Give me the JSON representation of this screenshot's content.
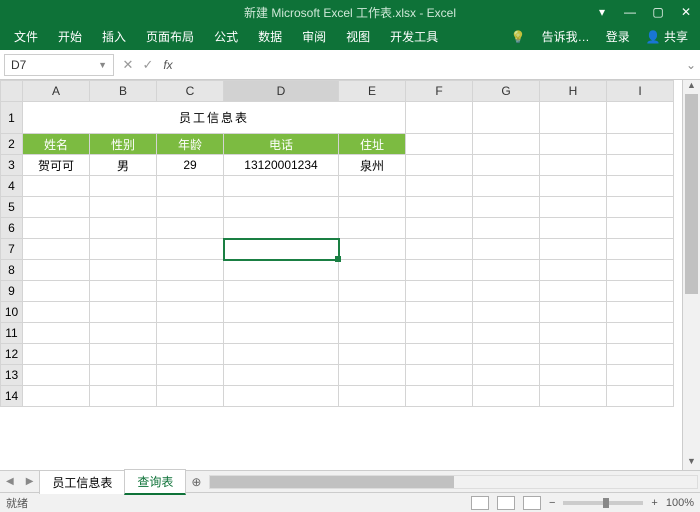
{
  "window": {
    "title": "新建 Microsoft Excel 工作表.xlsx - Excel"
  },
  "menu": {
    "file": "文件",
    "home": "开始",
    "insert": "插入",
    "layout": "页面布局",
    "formula": "公式",
    "data": "数据",
    "review": "审阅",
    "view": "视图",
    "dev": "开发工具",
    "tellme": "告诉我…",
    "login": "登录",
    "share": "共享"
  },
  "namebox": {
    "ref": "D7"
  },
  "columns": [
    "A",
    "B",
    "C",
    "D",
    "E",
    "F",
    "G",
    "H",
    "I"
  ],
  "rows": [
    "1",
    "2",
    "3",
    "4",
    "5",
    "6",
    "7",
    "8",
    "9",
    "10",
    "11",
    "12",
    "13",
    "14"
  ],
  "sheet": {
    "title": "员工信息表",
    "headers": {
      "a": "姓名",
      "b": "性别",
      "c": "年龄",
      "d": "电话",
      "e": "住址"
    },
    "row3": {
      "a": "贺可可",
      "b": "男",
      "c": "29",
      "d": "13120001234",
      "e": "泉州"
    }
  },
  "tabs": {
    "t1": "员工信息表",
    "t2": "查询表"
  },
  "status": {
    "ready": "就绪",
    "zoom": "100%"
  },
  "chart_data": {
    "type": "table",
    "title": "员工信息表",
    "columns": [
      "姓名",
      "性别",
      "年龄",
      "电话",
      "住址"
    ],
    "rows": [
      [
        "贺可可",
        "男",
        29,
        "13120001234",
        "泉州"
      ]
    ]
  }
}
